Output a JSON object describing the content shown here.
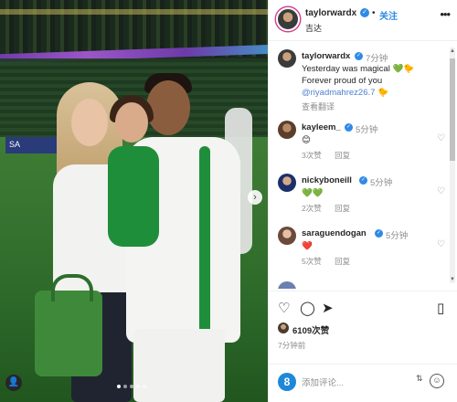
{
  "post": {
    "username": "taylorwardx",
    "follow_label": "关注",
    "location": "吉达",
    "more_label": "•••"
  },
  "photo": {
    "adboard_text": "SA",
    "user_chip": "👤",
    "next_label": "›"
  },
  "caption": {
    "username": "taylorwardx",
    "time": "7分钟",
    "line1": "Yesterday was magical 💚🐤",
    "line2": "Forever proud of you",
    "mention": "@riyadmahrez26.7",
    "mention_emoji": "🐤",
    "translate": "查看翻译"
  },
  "comments": [
    {
      "username": "kayleem_",
      "time": "5分钟",
      "text": "😊",
      "likes": "3次赞",
      "reply": "回复"
    },
    {
      "username": "nickyboneill",
      "time": "5分钟",
      "text": "💚💚",
      "likes": "2次赞",
      "reply": "回复"
    },
    {
      "username": "saraguendogan",
      "time": "5分钟",
      "text": "❤️",
      "likes": "5次赞",
      "reply": "回复"
    }
  ],
  "actions": {
    "likes_count": "6109次赞",
    "posted_ago": "7分钟前"
  },
  "composer": {
    "placeholder": "添加评论...",
    "user_badge": "8"
  },
  "colors": {
    "accent_blue": "#2f8ae5",
    "mention_blue": "#4f7fcf",
    "text": "#262626",
    "muted": "#8e8e8e"
  }
}
